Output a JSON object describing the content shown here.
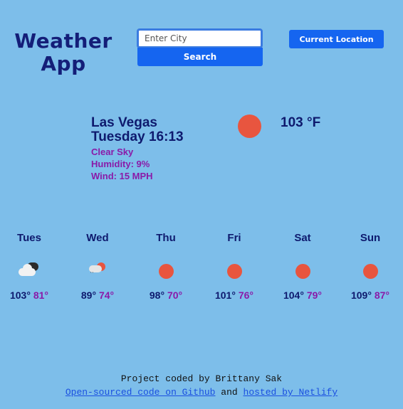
{
  "header": {
    "title": "Weather App",
    "search_placeholder": "Enter City",
    "search_label": "Search",
    "location_label": "Current Location"
  },
  "current": {
    "city": "Las Vegas",
    "datetime": "Tuesday 16:13",
    "description": "Clear Sky",
    "humidity": "Humidity: 9%",
    "wind": "Wind: 15 MPH",
    "temperature": "103 °F",
    "icon": "sun-icon"
  },
  "forecast": [
    {
      "day": "Tues",
      "high": "103°",
      "low": "81°",
      "icon": "cloudy-icon"
    },
    {
      "day": "Wed",
      "high": "89°",
      "low": "74°",
      "icon": "rain-icon"
    },
    {
      "day": "Thu",
      "high": "98°",
      "low": "70°",
      "icon": "sun-icon"
    },
    {
      "day": "Fri",
      "high": "101°",
      "low": "76°",
      "icon": "sun-icon"
    },
    {
      "day": "Sat",
      "high": "104°",
      "low": "79°",
      "icon": "sun-icon"
    },
    {
      "day": "Sun",
      "high": "109°",
      "low": "87°",
      "icon": "sun-icon"
    }
  ],
  "footer": {
    "credit": "Project coded by Brittany Sak",
    "github_link": "Open-sourced code on Github",
    "and_text": "and",
    "netlify_link": "hosted by Netlify"
  },
  "colors": {
    "background": "#7dbeea",
    "accent": "#1565f0",
    "primary_text": "#0e1a6e",
    "secondary_text": "#8a1aa8",
    "sun": "#e8553f"
  }
}
